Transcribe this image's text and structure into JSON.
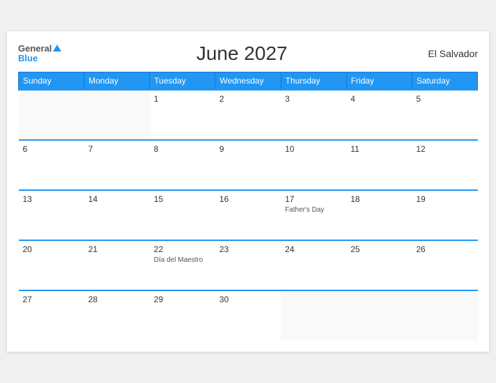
{
  "header": {
    "logo_general": "General",
    "logo_blue": "Blue",
    "title": "June 2027",
    "country": "El Salvador"
  },
  "weekdays": [
    "Sunday",
    "Monday",
    "Tuesday",
    "Wednesday",
    "Thursday",
    "Friday",
    "Saturday"
  ],
  "weeks": [
    [
      {
        "day": "",
        "empty": true
      },
      {
        "day": "",
        "empty": true
      },
      {
        "day": "1"
      },
      {
        "day": "2"
      },
      {
        "day": "3"
      },
      {
        "day": "4"
      },
      {
        "day": "5"
      }
    ],
    [
      {
        "day": "6"
      },
      {
        "day": "7"
      },
      {
        "day": "8"
      },
      {
        "day": "9"
      },
      {
        "day": "10"
      },
      {
        "day": "11"
      },
      {
        "day": "12"
      }
    ],
    [
      {
        "day": "13"
      },
      {
        "day": "14"
      },
      {
        "day": "15"
      },
      {
        "day": "16"
      },
      {
        "day": "17",
        "event": "Father's Day"
      },
      {
        "day": "18"
      },
      {
        "day": "19"
      }
    ],
    [
      {
        "day": "20"
      },
      {
        "day": "21"
      },
      {
        "day": "22",
        "event": "Día del Maestro"
      },
      {
        "day": "23"
      },
      {
        "day": "24"
      },
      {
        "day": "25"
      },
      {
        "day": "26"
      }
    ],
    [
      {
        "day": "27"
      },
      {
        "day": "28"
      },
      {
        "day": "29"
      },
      {
        "day": "30"
      },
      {
        "day": "",
        "empty": true
      },
      {
        "day": "",
        "empty": true
      },
      {
        "day": "",
        "empty": true
      }
    ]
  ]
}
